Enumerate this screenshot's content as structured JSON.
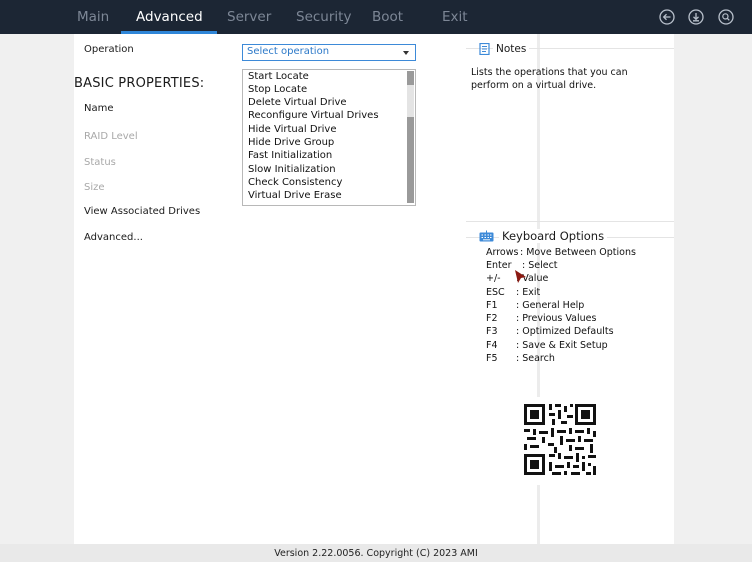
{
  "nav": {
    "tabs": [
      {
        "label": "Main"
      },
      {
        "label": "Advanced"
      },
      {
        "label": "Server"
      },
      {
        "label": "Security"
      },
      {
        "label": "Boot"
      },
      {
        "label": "Exit"
      }
    ],
    "active_tab": "Advanced",
    "icons": [
      "back-icon",
      "download-icon",
      "search-icon"
    ]
  },
  "form": {
    "operation_label": "Operation",
    "operation_value": "Select operation",
    "section_title": "BASIC PROPERTIES:",
    "fields": [
      {
        "label": "Name",
        "disabled": false
      },
      {
        "label": "RAID Level",
        "disabled": true
      },
      {
        "label": "Status",
        "disabled": true
      },
      {
        "label": "Size",
        "disabled": true
      },
      {
        "label": "View Associated Drives",
        "disabled": false
      },
      {
        "label": "Advanced...",
        "disabled": false
      }
    ]
  },
  "dropdown": {
    "options": [
      "Start Locate",
      "Stop Locate",
      "Delete Virtual Drive",
      "Reconfigure Virtual Drives",
      "Hide Virtual Drive",
      "Hide Drive Group",
      "Fast Initialization",
      "Slow Initialization",
      "Check Consistency",
      "Virtual Drive Erase"
    ]
  },
  "notes": {
    "title": "Notes",
    "text": "Lists the operations that you can perform on a virtual drive."
  },
  "keyboard": {
    "title": "Keyboard Options",
    "rows": [
      {
        "key": "Arrows",
        "desc": ": Move Between Options"
      },
      {
        "key": "Enter",
        "desc": ": Select"
      },
      {
        "key": "+/-",
        "desc": ": Value"
      },
      {
        "key": "ESC",
        "desc": ": Exit"
      },
      {
        "key": "F1",
        "desc": ": General Help"
      },
      {
        "key": "F2",
        "desc": ": Previous Values"
      },
      {
        "key": "F3",
        "desc": ": Optimized Defaults"
      },
      {
        "key": "F4",
        "desc": ": Save & Exit Setup"
      },
      {
        "key": "F5",
        "desc": ": Search"
      }
    ]
  },
  "footer": {
    "text": "Version 2.22.0056. Copyright (C) 2023 AMI"
  },
  "colors": {
    "topbar": "#1c2634",
    "accent": "#2f86d8",
    "select_text": "#2b78c8",
    "cursor": "#8b1a12"
  }
}
